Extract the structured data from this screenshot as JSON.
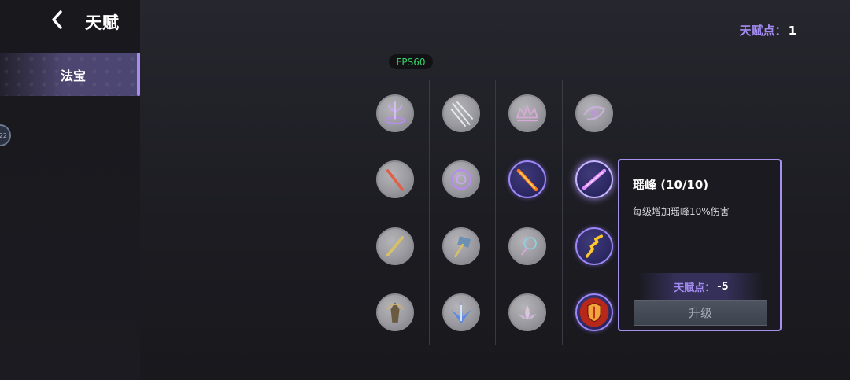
{
  "header": {
    "title": "天赋",
    "back_icon": "chevron-left-icon"
  },
  "sidebar": {
    "tabs": [
      {
        "label": "法宝",
        "active": true
      }
    ],
    "edge_badge": "22"
  },
  "talent_points": {
    "label": "天赋点：",
    "value": "1"
  },
  "fps": {
    "text": "FPS60",
    "color": "#36d16b"
  },
  "grid": {
    "columns": 4,
    "rows": 4,
    "nodes": [
      {
        "icon": "magic-circle-icon",
        "state": "locked"
      },
      {
        "icon": "lightning-slash-icon",
        "state": "locked"
      },
      {
        "icon": "crown-arc-icon",
        "state": "locked"
      },
      {
        "icon": "swirl-orb-icon",
        "state": "locked"
      },
      {
        "icon": "fire-sword-icon",
        "state": "locked"
      },
      {
        "icon": "rune-disc-icon",
        "state": "locked"
      },
      {
        "icon": "flame-sword-icon",
        "state": "unlocked"
      },
      {
        "icon": "purple-blade-icon",
        "state": "selected"
      },
      {
        "icon": "golden-sword-icon",
        "state": "locked"
      },
      {
        "icon": "hammer-icon",
        "state": "locked"
      },
      {
        "icon": "ring-flail-icon",
        "state": "locked"
      },
      {
        "icon": "gold-lightning-sword-icon",
        "state": "unlocked"
      },
      {
        "icon": "guardian-statue-icon",
        "state": "locked"
      },
      {
        "icon": "ice-burst-icon",
        "state": "locked"
      },
      {
        "icon": "lotus-icon",
        "state": "locked"
      },
      {
        "icon": "fire-shield-icon",
        "state": "unlocked"
      }
    ]
  },
  "tooltip": {
    "title": "瑶峰 (10/10)",
    "description": "每级增加瑶峰10%伤害",
    "cost_label": "天赋点：",
    "cost_value": "-5",
    "upgrade_label": "升级"
  },
  "colors": {
    "accent": "#a48bf2",
    "border": "#a690ee",
    "background": "#1f1f25",
    "locked_node": "#9a9aa0",
    "unlocked_node": "#2e2a66"
  }
}
